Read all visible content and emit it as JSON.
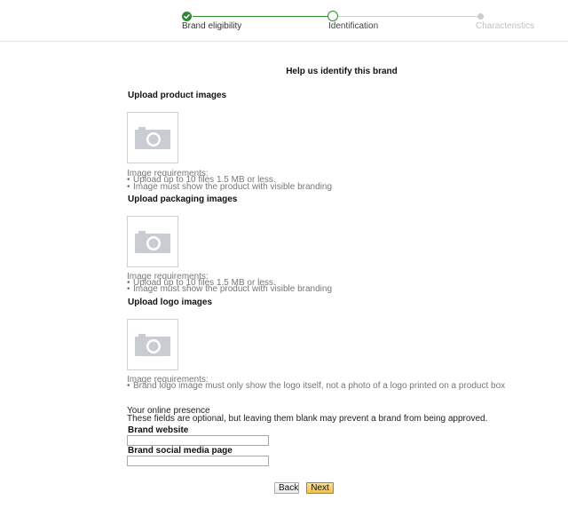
{
  "stepper": {
    "steps": [
      {
        "label": "Brand eligibility",
        "state": "complete"
      },
      {
        "label": "Identification",
        "state": "current"
      },
      {
        "label": "Characteristics",
        "state": "upcoming"
      }
    ],
    "colors": {
      "complete": "#2e8b2e",
      "current": "#2e8b2e",
      "upcoming": "#c8c8c8"
    }
  },
  "main": {
    "title": "Help us identify this brand"
  },
  "sections": [
    {
      "heading": "Upload product images",
      "icon": "camera-icon",
      "requirements_title": "Image requirements:",
      "requirements": [
        "Upload up to 10 files 1.5 MB or less.",
        "Image must show the product with visible branding"
      ]
    },
    {
      "heading": "Upload packaging images",
      "icon": "camera-icon",
      "requirements_title": "Image requirements:",
      "requirements": [
        "Upload up to 10 files 1.5 MB or less.",
        "Image must show the product with visible branding"
      ]
    },
    {
      "heading": "Upload logo images",
      "icon": "camera-icon",
      "requirements_title": "Image requirements:",
      "requirements": [
        "Brand logo image must only show the logo itself, not a photo of a logo printed on a product box"
      ]
    }
  ],
  "online": {
    "title": "Your online presence",
    "note": "These fields are optional, but leaving them blank may prevent a brand from being approved.",
    "website_label": "Brand website",
    "website_value": "",
    "social_label": "Brand social media page",
    "social_value": ""
  },
  "buttons": {
    "back": "Back",
    "next": "Next"
  }
}
